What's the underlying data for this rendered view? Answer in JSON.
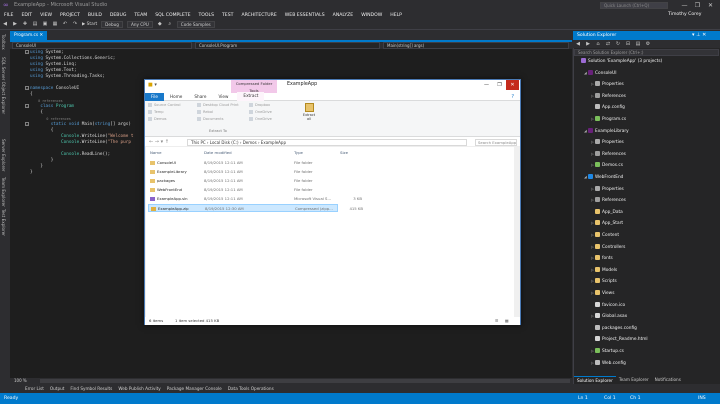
{
  "window": {
    "title": "ExampleApp - Microsoft Visual Studio",
    "quick_launch_placeholder": "Quick Launch (Ctrl+Q)",
    "user": "Timothy Corey",
    "controls": [
      "—",
      "❐",
      "✕"
    ]
  },
  "menu": [
    "FILE",
    "EDIT",
    "VIEW",
    "PROJECT",
    "BUILD",
    "DEBUG",
    "TEAM",
    "SQL COMPLETE",
    "TOOLS",
    "TEST",
    "ARCHITECTURE",
    "WEB ESSENTIALS",
    "ANALYZE",
    "WINDOW",
    "HELP"
  ],
  "toolbar": {
    "start_label": "▶ Start",
    "config": "Debug",
    "platform": "Any CPU",
    "code_samples": "Code Samples"
  },
  "left_strip": [
    "Toolbox",
    "SQL Server Object Explorer",
    "Server Explorer",
    "Team Explorer",
    "Test Explorer"
  ],
  "editor": {
    "tab": "Program.cs",
    "nav": [
      "ConsoleUI",
      "ConsoleUI.Program",
      "Main(string[] args)"
    ],
    "lines": [
      {
        "parts": [
          {
            "c": "kw",
            "t": "using"
          },
          {
            "c": "",
            "t": " System;"
          }
        ]
      },
      {
        "parts": [
          {
            "c": "kw",
            "t": "using"
          },
          {
            "c": "",
            "t": " System.Collections.Generic;"
          }
        ]
      },
      {
        "parts": [
          {
            "c": "kw",
            "t": "using"
          },
          {
            "c": "",
            "t": " System.Linq;"
          }
        ]
      },
      {
        "parts": [
          {
            "c": "kw",
            "t": "using"
          },
          {
            "c": "",
            "t": " System.Text;"
          }
        ]
      },
      {
        "parts": [
          {
            "c": "kw",
            "t": "using"
          },
          {
            "c": "",
            "t": " System.Threading.Tasks;"
          }
        ]
      },
      {
        "parts": [
          {
            "c": "",
            "t": ""
          }
        ]
      },
      {
        "parts": [
          {
            "c": "kw",
            "t": "namespace"
          },
          {
            "c": "",
            "t": " ConsoleUI"
          }
        ]
      },
      {
        "parts": [
          {
            "c": "",
            "t": "{"
          }
        ]
      },
      {
        "parts": [
          {
            "c": "cm",
            "t": "    0 references"
          }
        ]
      },
      {
        "parts": [
          {
            "c": "",
            "t": "    "
          },
          {
            "c": "kw",
            "t": "class"
          },
          {
            "c": "",
            "t": " "
          },
          {
            "c": "ty",
            "t": "Program"
          }
        ]
      },
      {
        "parts": [
          {
            "c": "",
            "t": "    {"
          }
        ]
      },
      {
        "parts": [
          {
            "c": "cm",
            "t": "        0 references"
          }
        ]
      },
      {
        "parts": [
          {
            "c": "",
            "t": "        "
          },
          {
            "c": "kw",
            "t": "static void"
          },
          {
            "c": "",
            "t": " Main("
          },
          {
            "c": "kw",
            "t": "string"
          },
          {
            "c": "",
            "t": "[] args)"
          }
        ]
      },
      {
        "parts": [
          {
            "c": "",
            "t": "        {"
          }
        ]
      },
      {
        "parts": [
          {
            "c": "",
            "t": "            "
          },
          {
            "c": "ty",
            "t": "Console"
          },
          {
            "c": "",
            "t": ".WriteLine("
          },
          {
            "c": "st",
            "t": "\"Welcome t"
          }
        ]
      },
      {
        "parts": [
          {
            "c": "",
            "t": "            "
          },
          {
            "c": "ty",
            "t": "Console"
          },
          {
            "c": "",
            "t": ".WriteLine("
          },
          {
            "c": "st",
            "t": "\"The purp"
          }
        ]
      },
      {
        "parts": [
          {
            "c": "",
            "t": ""
          }
        ]
      },
      {
        "parts": [
          {
            "c": "",
            "t": "            "
          },
          {
            "c": "ty",
            "t": "Console"
          },
          {
            "c": "",
            "t": ".ReadLine();"
          }
        ]
      },
      {
        "parts": [
          {
            "c": "",
            "t": "        }"
          }
        ]
      },
      {
        "parts": [
          {
            "c": "",
            "t": "    }"
          }
        ]
      },
      {
        "parts": [
          {
            "c": "",
            "t": "}"
          }
        ]
      }
    ],
    "zoom": "100 %"
  },
  "bottom_tabs": [
    "Error List",
    "Output",
    "Find Symbol Results",
    "Web Publish Activity",
    "Package Manager Console",
    "Data Tools Operations"
  ],
  "statusbar": {
    "ready": "Ready",
    "ln": "Ln 1",
    "col": "Col 1",
    "ch": "Ch 1",
    "ins": "INS"
  },
  "solution_explorer": {
    "title": "Solution Explorer",
    "search_placeholder": "Search Solution Explorer (Ctrl+;)",
    "items": [
      {
        "text": "Solution 'ExampleApp' (3 projects)",
        "level": 0,
        "icon": "solution",
        "arrow": ""
      },
      {
        "text": "ConsoleUI",
        "level": 1,
        "icon": "project",
        "arrow": "◢"
      },
      {
        "text": "Properties",
        "level": 2,
        "icon": "wrench",
        "arrow": "▷"
      },
      {
        "text": "References",
        "level": 2,
        "icon": "refs",
        "arrow": "▷"
      },
      {
        "text": "App.config",
        "level": 2,
        "icon": "config",
        "arrow": ""
      },
      {
        "text": "Program.cs",
        "level": 2,
        "icon": "cs",
        "arrow": "▷"
      },
      {
        "text": "ExampleLibrary",
        "level": 1,
        "icon": "project",
        "arrow": "◢"
      },
      {
        "text": "Properties",
        "level": 2,
        "icon": "wrench",
        "arrow": "▷"
      },
      {
        "text": "References",
        "level": 2,
        "icon": "refs",
        "arrow": "▷"
      },
      {
        "text": "Demos.cs",
        "level": 2,
        "icon": "cs",
        "arrow": "▷"
      },
      {
        "text": "WebFrontEnd",
        "level": 1,
        "icon": "web",
        "arrow": "◢"
      },
      {
        "text": "Properties",
        "level": 2,
        "icon": "wrench",
        "arrow": "▷"
      },
      {
        "text": "References",
        "level": 2,
        "icon": "refs",
        "arrow": "▷"
      },
      {
        "text": "App_Data",
        "level": 2,
        "icon": "folder",
        "arrow": ""
      },
      {
        "text": "App_Start",
        "level": 2,
        "icon": "folder",
        "arrow": "▷"
      },
      {
        "text": "Content",
        "level": 2,
        "icon": "folder",
        "arrow": "▷"
      },
      {
        "text": "Controllers",
        "level": 2,
        "icon": "folder",
        "arrow": "▷"
      },
      {
        "text": "fonts",
        "level": 2,
        "icon": "folder",
        "arrow": "▷"
      },
      {
        "text": "Models",
        "level": 2,
        "icon": "folder",
        "arrow": "▷"
      },
      {
        "text": "Scripts",
        "level": 2,
        "icon": "folder",
        "arrow": "▷"
      },
      {
        "text": "Views",
        "level": 2,
        "icon": "folder",
        "arrow": "▷"
      },
      {
        "text": "favicon.ico",
        "level": 2,
        "icon": "file",
        "arrow": ""
      },
      {
        "text": "Global.asax",
        "level": 2,
        "icon": "file",
        "arrow": "▷"
      },
      {
        "text": "packages.config",
        "level": 2,
        "icon": "config",
        "arrow": ""
      },
      {
        "text": "Project_Readme.html",
        "level": 2,
        "icon": "file",
        "arrow": ""
      },
      {
        "text": "Startup.cs",
        "level": 2,
        "icon": "cs",
        "arrow": "▷"
      },
      {
        "text": "Web.config",
        "level": 2,
        "icon": "config",
        "arrow": "▷"
      }
    ],
    "bottom_tabs": [
      "Solution Explorer",
      "Team Explorer",
      "Notifications"
    ]
  },
  "file_explorer": {
    "title": "ExampleApp",
    "context_tab_header": "Compressed Folder Tools",
    "ribbon_tabs": [
      "File",
      "Home",
      "Share",
      "View",
      "Extract"
    ],
    "ribbon_items": [
      "Source Control",
      "Desktop Cloud Print",
      "Dropbox",
      "Temp",
      "Rebol",
      "OneDrive",
      "Demos",
      "Documents",
      "OneDrive"
    ],
    "extract_all": "Extract all",
    "group_label": "Extract To",
    "address": "This PC  ›  Local Disk (C:)  ›  Demos  ›  ExampleApp",
    "search_placeholder": "Search ExampleApp",
    "columns": [
      "Name",
      "Date modified",
      "Type",
      "Size"
    ],
    "rows": [
      {
        "name": "ConsoleUI",
        "date": "8/19/2015 12:11 AM",
        "type": "File folder",
        "size": "",
        "icon": "folder"
      },
      {
        "name": "ExampleLibrary",
        "date": "8/19/2015 12:11 AM",
        "type": "File folder",
        "size": "",
        "icon": "folder"
      },
      {
        "name": "packages",
        "date": "8/19/2015 12:11 AM",
        "type": "File folder",
        "size": "",
        "icon": "folder"
      },
      {
        "name": "WebFrontEnd",
        "date": "8/19/2015 12:11 AM",
        "type": "File folder",
        "size": "",
        "icon": "folder"
      },
      {
        "name": "ExampleApp.sln",
        "date": "8/19/2015 12:11 AM",
        "type": "Microsoft Visual S...",
        "size": "3 KB",
        "icon": "sln"
      },
      {
        "name": "ExampleApp.zip",
        "date": "8/19/2015 12:30 AM",
        "type": "Compressed (zipp...",
        "size": "415 KB",
        "icon": "zip"
      }
    ],
    "status_count": "6 items",
    "status_selected": "1 item selected  415 KB"
  },
  "colors": {
    "accent": "#007acc",
    "folder": "#e8c36b",
    "cs": "#68217a"
  }
}
